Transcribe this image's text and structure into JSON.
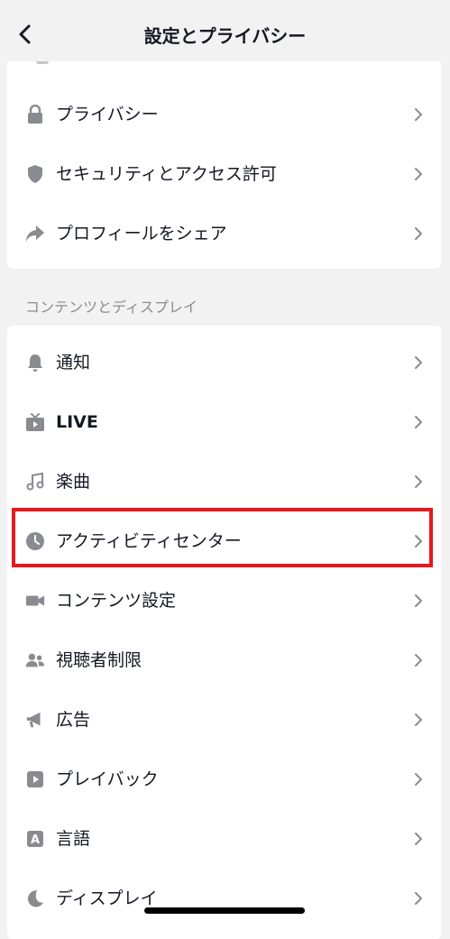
{
  "header": {
    "title": "設定とプライバシー",
    "back_icon": "chevron-left-icon"
  },
  "section1": {
    "items": [
      {
        "label": "プライバシー",
        "icon": "lock-icon"
      },
      {
        "label": "セキュリティとアクセス許可",
        "icon": "shield-icon"
      },
      {
        "label": "プロフィールをシェア",
        "icon": "share-arrow-icon"
      }
    ]
  },
  "section2": {
    "title": "コンテンツとディスプレイ",
    "items": [
      {
        "label": "通知",
        "icon": "bell-icon"
      },
      {
        "label": "LIVE",
        "icon": "tv-icon"
      },
      {
        "label": "楽曲",
        "icon": "music-note-icon"
      },
      {
        "label": "アクティビティセンター",
        "icon": "clock-icon",
        "highlighted": true
      },
      {
        "label": "コンテンツ設定",
        "icon": "video-camera-icon"
      },
      {
        "label": "視聴者制限",
        "icon": "users-icon"
      },
      {
        "label": "広告",
        "icon": "megaphone-icon"
      },
      {
        "label": "プレイバック",
        "icon": "play-icon"
      },
      {
        "label": "言語",
        "icon": "language-icon",
        "icon_text": "A"
      },
      {
        "label": "ディスプレイ",
        "icon": "moon-icon"
      }
    ]
  },
  "colors": {
    "highlight_border": "#e8181b",
    "icon": "#8a8b91",
    "text": "#161823",
    "section_title": "#8a8b91"
  }
}
